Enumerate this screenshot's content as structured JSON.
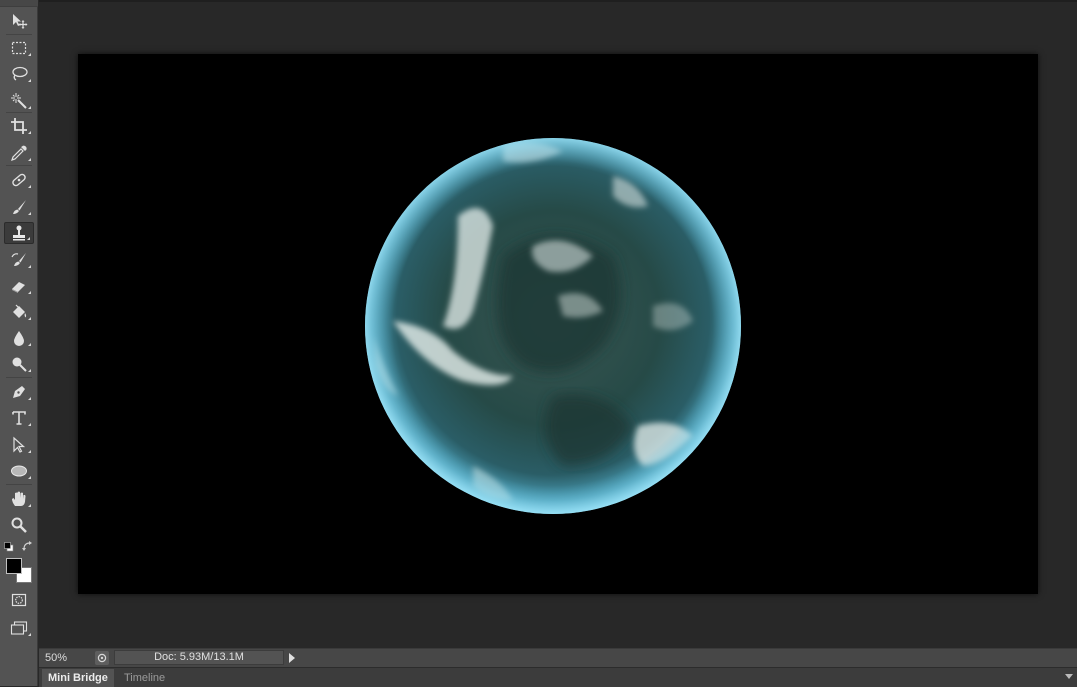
{
  "tools": [
    {
      "name": "move-tool-icon"
    },
    {
      "name": "rectangular-marquee-tool-icon"
    },
    {
      "name": "lasso-tool-icon"
    },
    {
      "name": "magic-wand-tool-icon"
    },
    {
      "name": "crop-tool-icon"
    },
    {
      "name": "eyedropper-tool-icon"
    },
    {
      "name": "spot-healing-brush-tool-icon"
    },
    {
      "name": "brush-tool-icon"
    },
    {
      "name": "clone-stamp-tool-icon",
      "active": true
    },
    {
      "name": "history-brush-tool-icon"
    },
    {
      "name": "eraser-tool-icon"
    },
    {
      "name": "paint-bucket-tool-icon"
    },
    {
      "name": "blur-tool-icon"
    },
    {
      "name": "dodge-tool-icon"
    },
    {
      "name": "pen-tool-icon"
    },
    {
      "name": "type-tool-icon"
    },
    {
      "name": "path-selection-tool-icon"
    },
    {
      "name": "ellipse-tool-icon"
    },
    {
      "name": "hand-tool-icon"
    },
    {
      "name": "zoom-tool-icon"
    }
  ],
  "colors": {
    "foreground": "#000000",
    "background": "#ffffff",
    "accent": "#4fb3d4"
  },
  "status": {
    "zoom": "50%",
    "doc_info": "Doc: 5.93M/13.1M"
  },
  "panel_tabs": [
    {
      "label": "Mini Bridge",
      "active": true
    },
    {
      "label": "Timeline",
      "active": false
    }
  ]
}
